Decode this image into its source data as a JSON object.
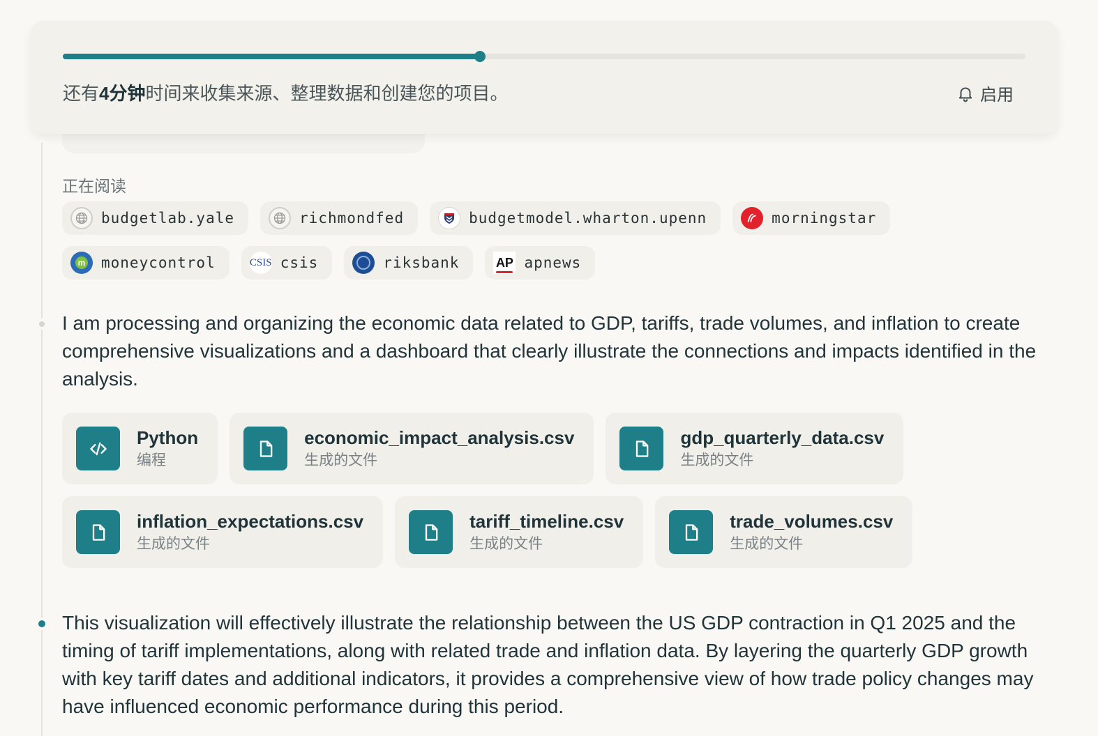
{
  "progress": {
    "prefix": "还有",
    "highlight": "4分钟",
    "suffix": "时间来收集来源、整理数据和创建您的项目。",
    "fraction": 0.433,
    "enable_label": "启用"
  },
  "reading": {
    "label": "正在阅读",
    "sources": [
      {
        "name": "budgetlab.yale",
        "icon": "globe-icon"
      },
      {
        "name": "richmondfed",
        "icon": "globe-icon"
      },
      {
        "name": "budgetmodel.wharton.upenn",
        "icon": "wharton-logo-icon"
      },
      {
        "name": "morningstar",
        "icon": "morningstar-logo-icon"
      },
      {
        "name": "moneycontrol",
        "icon": "moneycontrol-logo-icon"
      },
      {
        "name": "csis",
        "icon": "csis-logo-icon",
        "logo_text": "CSIS"
      },
      {
        "name": "riksbank",
        "icon": "riksbank-logo-icon"
      },
      {
        "name": "apnews",
        "icon": "ap-logo-icon",
        "logo_text": "AP"
      }
    ]
  },
  "step1": {
    "text": "I am processing and organizing the economic data related to GDP, tariffs, trade volumes, and inflation to create comprehensive visualizations and a dashboard that clearly illustrate the connections and impacts identified in the analysis."
  },
  "files": [
    {
      "name": "Python",
      "sub": "编程",
      "icon": "code-icon"
    },
    {
      "name": "economic_impact_analysis.csv",
      "sub": "生成的文件",
      "icon": "file-icon"
    },
    {
      "name": "gdp_quarterly_data.csv",
      "sub": "生成的文件",
      "icon": "file-icon"
    },
    {
      "name": "inflation_expectations.csv",
      "sub": "生成的文件",
      "icon": "file-icon"
    },
    {
      "name": "tariff_timeline.csv",
      "sub": "生成的文件",
      "icon": "file-icon"
    },
    {
      "name": "trade_volumes.csv",
      "sub": "生成的文件",
      "icon": "file-icon"
    }
  ],
  "step2": {
    "text": "This visualization will effectively illustrate the relationship between the US GDP contraction in Q1 2025 and the timing of tariff implementations, along with related trade and inflation data. By layering the quarterly GDP growth with key tariff dates and additional indicators, it provides a comprehensive view of how trade policy changes may have influenced economic performance during this period."
  },
  "colors": {
    "accent": "#1f7f89",
    "background": "#f9f8f4",
    "card": "#f0efea"
  }
}
